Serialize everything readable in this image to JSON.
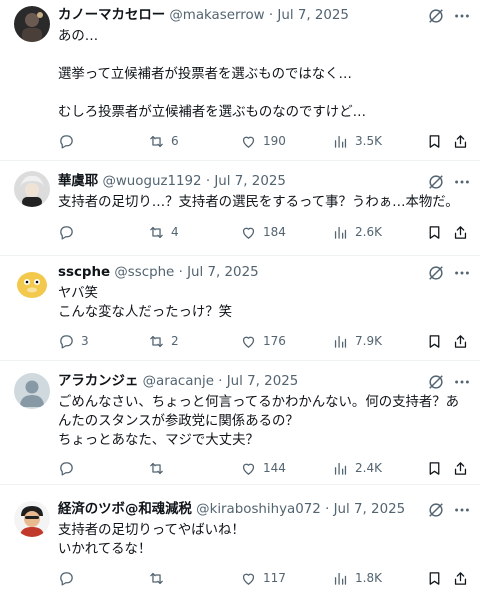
{
  "tweets": [
    {
      "name": "カノーマカセロー",
      "handle": "@makaserrow",
      "dot": "·",
      "time": "Jul 7, 2025",
      "lines": [
        "あの…",
        "",
        "選挙って立候補者が投票者を選ぶものではなく…",
        "",
        "むしろ投票者が立候補者を選ぶものなのですけど…"
      ],
      "replies": "",
      "reposts": "6",
      "likes": "190",
      "views": "3.5K"
    },
    {
      "name": "華虞耶",
      "handle": "@wuoguz1192",
      "dot": "·",
      "time": "Jul 7, 2025",
      "lines": [
        "支持者の足切り…？支持者の選民をするって事？うわぁ…本物だ。"
      ],
      "replies": "",
      "reposts": "4",
      "likes": "184",
      "views": "2.6K"
    },
    {
      "name": "sscphe",
      "handle": "@sscphe",
      "dot": "·",
      "time": "Jul 7, 2025",
      "lines": [
        "ヤバ笑",
        "こんな変な人だったっけ？笑"
      ],
      "replies": "3",
      "reposts": "2",
      "likes": "176",
      "views": "7.9K"
    },
    {
      "name": "アラカンジェ",
      "handle": "@aracanje",
      "dot": "·",
      "time": "Jul 7, 2025",
      "lines": [
        "ごめんなさい、ちょっと何言ってるかわかんない。何の支持者？あ",
        "んたのスタンスが参政党に関係あるの？",
        "ちょっとあなた、マジで大丈夫？"
      ],
      "replies": "",
      "reposts": "",
      "likes": "144",
      "views": "2.4K"
    },
    {
      "name": "経済のツボ@和魂減税",
      "handle": "@kiraboshihya072",
      "dot": "·",
      "time": "Jul 7, 2025",
      "lines": [
        "支持者の足切りってやばいね！",
        "いかれてるな！"
      ],
      "replies": "",
      "reposts": "",
      "likes": "117",
      "views": "1.8K"
    }
  ],
  "icons": {
    "grok": "grok-icon",
    "more": "more-icon",
    "reply": "reply-icon",
    "repost": "repost-icon",
    "like": "like-icon",
    "views": "views-icon",
    "bookmark": "bookmark-icon",
    "share": "share-icon"
  },
  "colors": {
    "text": "#0f1419",
    "secondary": "#536471",
    "divider": "#eff3f4"
  }
}
